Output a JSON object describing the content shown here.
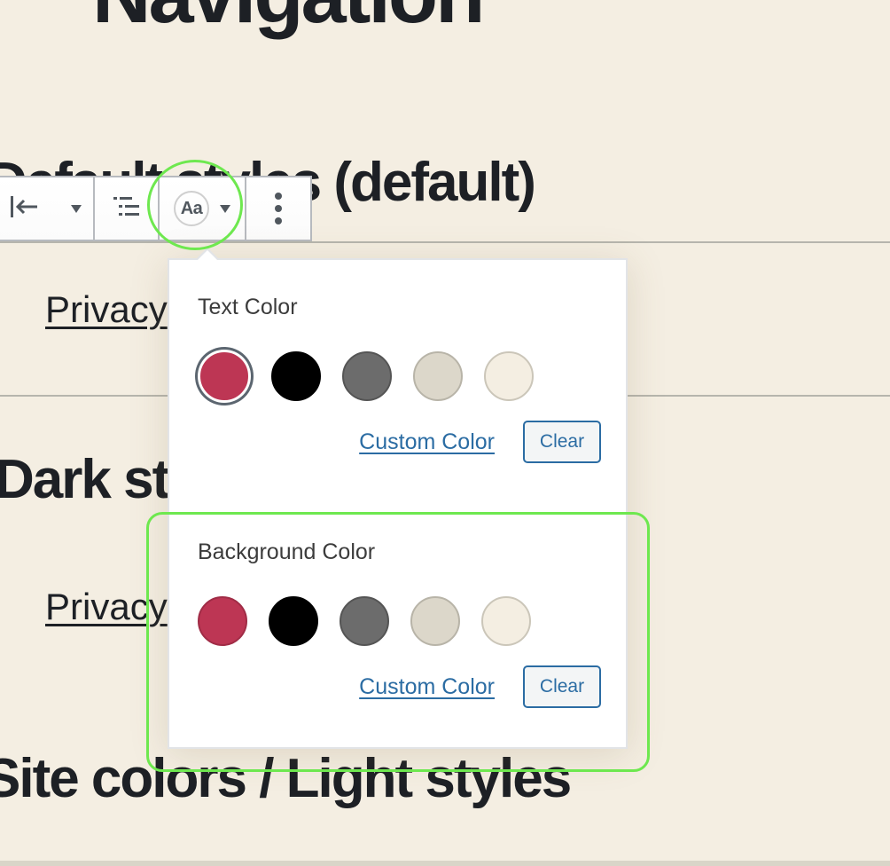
{
  "page": {
    "headings": {
      "top": "Navigation",
      "default_styles": "Default styles (default)",
      "styles": "Dark styles",
      "light_styles": "Site colors / Light styles"
    },
    "links": {
      "privacy_1": "Privacy",
      "privacy_2": "Privacy"
    }
  },
  "toolbar": {
    "justify_icon": "justify-left-icon",
    "justify_dropdown": "chevron-down-icon",
    "list_icon": "submenu-list-icon",
    "format_label": "Aa",
    "format_dropdown": "chevron-down-icon",
    "more_icon": "more-vertical-icon"
  },
  "popover": {
    "text_color": {
      "label": "Text Color",
      "swatches": [
        {
          "name": "primary",
          "color": "#bd3654",
          "border": "#bd3654",
          "selected": true
        },
        {
          "name": "black",
          "color": "#000000",
          "border": "#000000",
          "selected": false
        },
        {
          "name": "dark-gray",
          "color": "#6c6c6c",
          "border": "#555555",
          "selected": false
        },
        {
          "name": "light-gray",
          "color": "#dcd7ca",
          "border": "#b8b4a8",
          "selected": false
        },
        {
          "name": "background",
          "color": "#f4eee2",
          "border": "#cbc6b9",
          "selected": false
        }
      ],
      "custom_label": "Custom Color",
      "clear_label": "Clear"
    },
    "background_color": {
      "label": "Background Color",
      "swatches": [
        {
          "name": "primary",
          "color": "#bd3654",
          "border": "#a02c46",
          "selected": false
        },
        {
          "name": "black",
          "color": "#000000",
          "border": "#000000",
          "selected": false
        },
        {
          "name": "dark-gray",
          "color": "#6c6c6c",
          "border": "#555555",
          "selected": false
        },
        {
          "name": "light-gray",
          "color": "#dcd7ca",
          "border": "#b8b4a8",
          "selected": false
        },
        {
          "name": "background",
          "color": "#f4eee2",
          "border": "#cbc6b9",
          "selected": false
        }
      ],
      "custom_label": "Custom Color",
      "clear_label": "Clear"
    }
  },
  "colors": {
    "page_background": "#f4eee2",
    "link_accent": "#2b6ca3",
    "highlight": "#6ee84f"
  }
}
